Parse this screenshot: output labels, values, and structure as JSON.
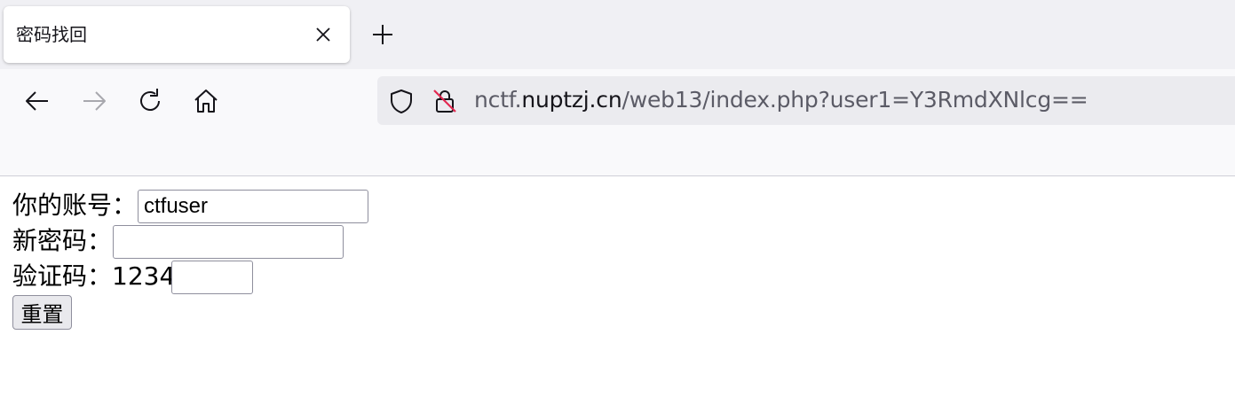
{
  "tab": {
    "title": "密码找回"
  },
  "urlbar": {
    "url_prefix": "nctf.",
    "url_host": "nuptzj.cn",
    "url_path": "/web13/index.php?user1=Y3RmdXNlcg=="
  },
  "form": {
    "account_label": "你的账号：",
    "account_value": "ctfuser",
    "new_password_label": "新密码：",
    "new_password_value": "",
    "captcha_label": "验证码：",
    "captcha_code": "1234",
    "captcha_value": "",
    "reset_label": "重置"
  },
  "icons": {
    "tab_close": "close-icon",
    "new_tab": "plus-icon",
    "back": "arrow-left-icon",
    "forward": "arrow-right-icon",
    "reload": "reload-icon",
    "home": "home-icon",
    "tracking": "shield-icon",
    "insecure": "insecure-lock-icon"
  }
}
